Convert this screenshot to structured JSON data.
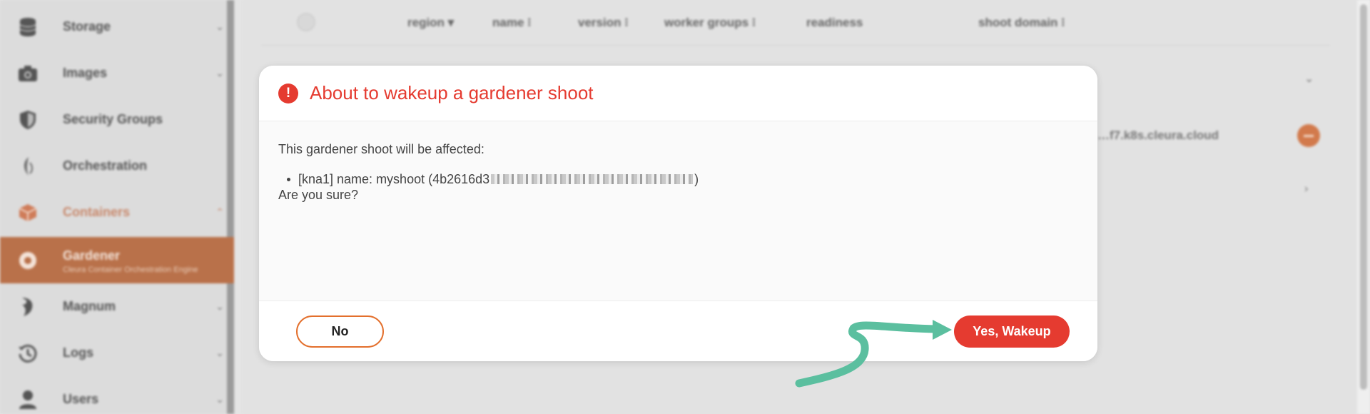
{
  "sidebar": {
    "items": [
      {
        "label": "Storage",
        "icon": "database-icon",
        "chevron": "⌄"
      },
      {
        "label": "Images",
        "icon": "camera-icon",
        "chevron": "⌄"
      },
      {
        "label": "Security Groups",
        "icon": "shield-icon"
      },
      {
        "label": "Orchestration",
        "icon": "orchestration-icon"
      },
      {
        "label": "Containers",
        "icon": "cube-icon",
        "chevron": "⌃"
      },
      {
        "label": "Gardener",
        "sub": "Cleura Container Orchestration Engine",
        "icon": "gardener-icon"
      },
      {
        "label": "Magnum",
        "icon": "magnum-icon",
        "chevron": "⌄"
      },
      {
        "label": "Logs",
        "icon": "history-icon",
        "chevron": "⌄"
      },
      {
        "label": "Users",
        "icon": "user-icon",
        "chevron": "⌄"
      }
    ]
  },
  "table": {
    "headers": {
      "region": "region ▾",
      "name": "name ⁝",
      "version": "version ⁝",
      "worker_groups": "worker groups ⁝",
      "readiness": "readiness",
      "shoot_domain": "shoot domain ⁝"
    },
    "row_domain": "…f7.k8s.cleura.cloud"
  },
  "modal": {
    "title": "About to wakeup a gardener shoot",
    "alert_symbol": "!",
    "body_intro": "This gardener shoot will be affected:",
    "item_prefix": "[kna1] name: myshoot (4b2616d3",
    "item_suffix": ")",
    "question": "Are you sure?",
    "no_label": "No",
    "yes_label": "Yes, Wakeup"
  },
  "colors": {
    "danger": "#e53b30",
    "cancel_border": "#e36f2c",
    "arrow": "#5bbf9f"
  }
}
